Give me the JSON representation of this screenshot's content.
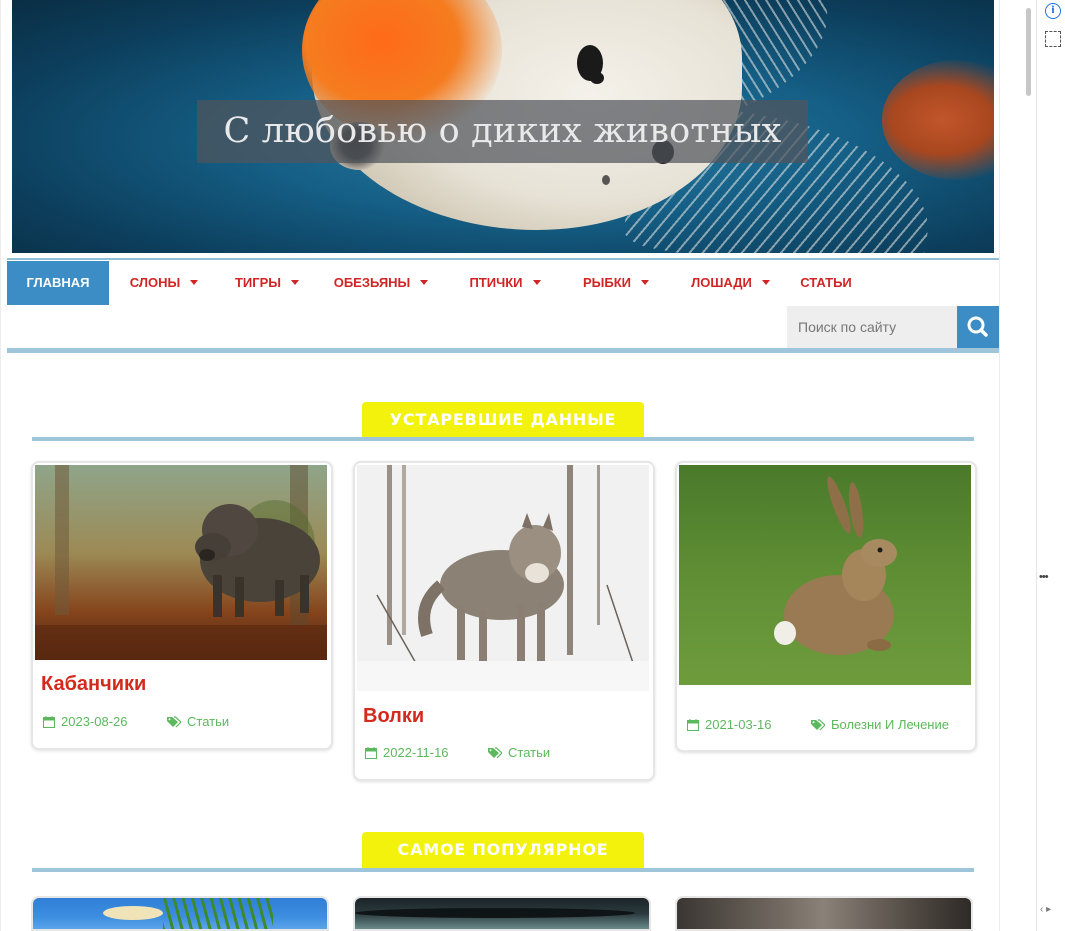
{
  "site": {
    "title": "С любовью о диких животных"
  },
  "nav": {
    "items": [
      {
        "label": "Главная",
        "has_dropdown": false,
        "active": true
      },
      {
        "label": "Слоны",
        "has_dropdown": true,
        "active": false
      },
      {
        "label": "Тигры",
        "has_dropdown": true,
        "active": false
      },
      {
        "label": "Обезьяны",
        "has_dropdown": true,
        "active": false
      },
      {
        "label": "Птички",
        "has_dropdown": true,
        "active": false
      },
      {
        "label": "Рыбки",
        "has_dropdown": true,
        "active": false
      },
      {
        "label": "Лошади",
        "has_dropdown": true,
        "active": false
      },
      {
        "label": "Статьи",
        "has_dropdown": false,
        "active": false
      }
    ]
  },
  "search": {
    "placeholder": "Поиск по сайту",
    "icon": "search-icon"
  },
  "sections": {
    "outdated": {
      "title": "УСТАРЕВШИЕ ДАННЫЕ",
      "cards": [
        {
          "title": "Кабанчики",
          "date": "2023-08-26",
          "category": "Статьи",
          "image": "wild-boar-photo"
        },
        {
          "title": "Волки",
          "date": "2022-11-16",
          "category": "Статьи",
          "image": "wolf-photo"
        },
        {
          "title": "",
          "date": "2021-03-16",
          "category": "Болезни И Лечение",
          "image": "hare-photo"
        }
      ]
    },
    "popular": {
      "title": "САМОЕ ПОПУЛЯРНОЕ",
      "cards": [
        {
          "image": "aquarium-fish-photo"
        },
        {
          "image": "dark-fish-photo"
        },
        {
          "image": "animal-fur-photo"
        }
      ]
    }
  },
  "colors": {
    "nav_active_bg": "#3c8cc5",
    "nav_text": "#d12525",
    "section_badge_bg": "#f2f20d",
    "accent_line": "#9ec5da",
    "card_title": "#d22a1c",
    "meta_green": "#5cb85c"
  }
}
